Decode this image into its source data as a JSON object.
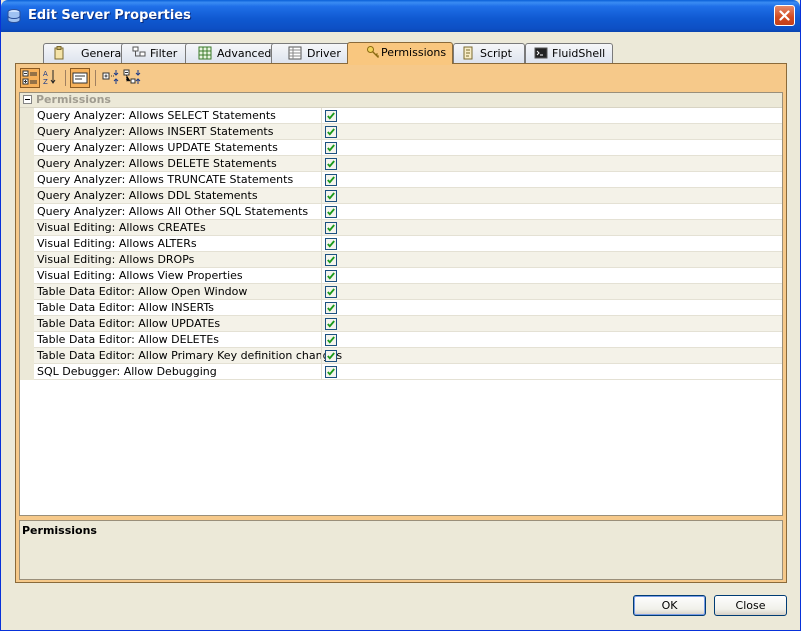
{
  "window": {
    "title": "Edit Server Properties",
    "icon": "server-db-icon"
  },
  "tabs": [
    {
      "label": "General",
      "icon": "general-icon",
      "active": false
    },
    {
      "label": "Filter",
      "icon": "filter-icon",
      "active": false
    },
    {
      "label": "Advanced",
      "icon": "advanced-grid-icon",
      "active": false
    },
    {
      "label": "Driver",
      "icon": "driver-icon",
      "active": false
    },
    {
      "label": "Permissions",
      "icon": "permissions-key-icon",
      "active": true
    },
    {
      "label": "Script",
      "icon": "script-icon",
      "active": false
    },
    {
      "label": "FluidShell",
      "icon": "fluidshell-icon",
      "active": false
    }
  ],
  "toolbar": {
    "buttons": [
      {
        "name": "categorized-view-button",
        "icon": "categorized-icon",
        "pressed": true
      },
      {
        "name": "alphabetical-sort-button",
        "icon": "sort-az-icon",
        "pressed": false
      },
      {
        "name": "show-description-button",
        "icon": "description-icon",
        "pressed": true
      },
      {
        "name": "expand-all-button",
        "icon": "expand-all-icon",
        "pressed": false
      },
      {
        "name": "collapse-all-button",
        "icon": "collapse-all-icon",
        "pressed": false
      }
    ]
  },
  "grid": {
    "category": "Permissions",
    "rows": [
      {
        "label": "Query Analyzer: Allows SELECT Statements",
        "checked": true
      },
      {
        "label": "Query Analyzer: Allows INSERT Statements",
        "checked": true
      },
      {
        "label": "Query Analyzer: Allows UPDATE Statements",
        "checked": true
      },
      {
        "label": "Query Analyzer: Allows DELETE Statements",
        "checked": true
      },
      {
        "label": "Query Analyzer: Allows TRUNCATE Statements",
        "checked": true
      },
      {
        "label": "Query Analyzer: Allows DDL Statements",
        "checked": true
      },
      {
        "label": "Query Analyzer: Allows All Other SQL Statements",
        "checked": true
      },
      {
        "label": "Visual Editing: Allows CREATEs",
        "checked": true
      },
      {
        "label": "Visual Editing: Allows ALTERs",
        "checked": true
      },
      {
        "label": "Visual Editing: Allows DROPs",
        "checked": true
      },
      {
        "label": "Visual Editing: Allows View Properties",
        "checked": true
      },
      {
        "label": "Table Data Editor: Allow Open Window",
        "checked": true
      },
      {
        "label": "Table Data Editor: Allow INSERTs",
        "checked": true
      },
      {
        "label": "Table Data Editor: Allow UPDATEs",
        "checked": true
      },
      {
        "label": "Table Data Editor: Allow DELETEs",
        "checked": true
      },
      {
        "label": "Table Data Editor: Allow Primary Key definition changes",
        "checked": true
      },
      {
        "label": "SQL Debugger: Allow Debugging",
        "checked": true
      }
    ]
  },
  "description": {
    "title": "Permissions"
  },
  "buttons": {
    "ok": "OK",
    "close": "Close"
  },
  "colors": {
    "titlebar": "#0a5fd8",
    "active_tab": "#f9c77f",
    "panel": "#f6c98a",
    "dialog_bg": "#ece9d8",
    "check": "#1a9a1a"
  }
}
